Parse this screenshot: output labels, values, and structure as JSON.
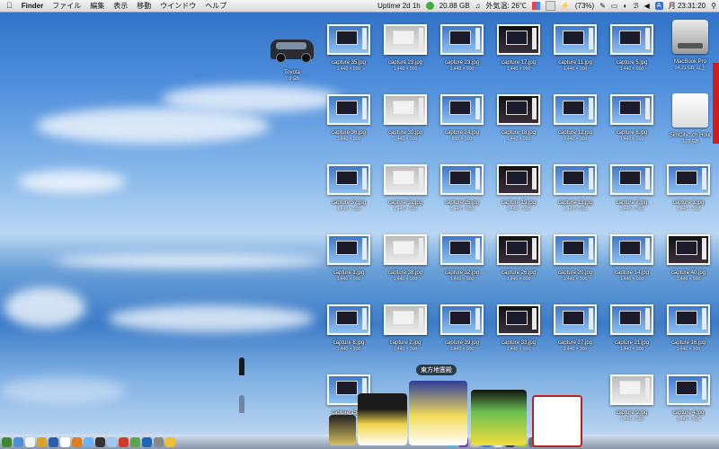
{
  "menubar": {
    "apple": "",
    "items": [
      "Finder",
      "ファイル",
      "編集",
      "表示",
      "移動",
      "ウインドウ",
      "ヘルプ"
    ],
    "status": {
      "uptime": "Uptime 2d 1h",
      "disk": "20.88 GB",
      "temperature": "外気温: 26℃",
      "battery": "(73%)",
      "clock": "月 23:31:20"
    }
  },
  "desktop": {
    "van_icon": {
      "label": "Toyota",
      "sub": "7.9 GB"
    },
    "drives": [
      {
        "label": "MacBook Pro",
        "sub": "24.21 GB, 以上"
      },
      {
        "label": "SimCity...ch Hour",
        "sub": "1.22 GB"
      }
    ],
    "files": [
      {
        "label": "capture 35.jpg",
        "sub": "1,440 × 900"
      },
      {
        "label": "capture 23.jpg",
        "sub": "1,440 × 900"
      },
      {
        "label": "capture 23.jpg",
        "sub": "1,440 × 900"
      },
      {
        "label": "capture 17.jpg",
        "sub": "1,440 × 900"
      },
      {
        "label": "capture 11.jpg",
        "sub": "1,440 × 900"
      },
      {
        "label": "capture 5.jpg",
        "sub": "1,440 × 900"
      },
      {
        "label": "capture 36.jpg",
        "sub": "1,440 × 900"
      },
      {
        "label": "capture 30.jpg",
        "sub": "1,440 × 900"
      },
      {
        "label": "capture 24.jpg",
        "sub": "800 × 600"
      },
      {
        "label": "capture 18.jpg",
        "sub": "1,440 × 900"
      },
      {
        "label": "capture 12.jpg",
        "sub": "1,440 × 900"
      },
      {
        "label": "capture 6.jpg",
        "sub": "1,440 × 900"
      },
      {
        "label": "capture 37.jpg",
        "sub": "1,440 × 900"
      },
      {
        "label": "capture 31.jpg",
        "sub": "1,440 × 900"
      },
      {
        "label": "capture 25.jpg",
        "sub": "1,440 × 900"
      },
      {
        "label": "capture 19.jpg",
        "sub": "1,440 × 900"
      },
      {
        "label": "capture 13.jpg",
        "sub": "1,440 × 900"
      },
      {
        "label": "capture 7.jpg",
        "sub": "1,440 × 900"
      },
      {
        "label": "capture 1.jpg",
        "sub": "1,440 × 900"
      },
      {
        "label": "capture 38.jpg",
        "sub": "1,440 × 900"
      },
      {
        "label": "capture 32.jpg",
        "sub": "1,440 × 900"
      },
      {
        "label": "capture 26.jpg",
        "sub": "1,440 × 900"
      },
      {
        "label": "capture 20.jpg",
        "sub": "1,440 × 900"
      },
      {
        "label": "capture 14.jpg",
        "sub": "1,440 × 900"
      },
      {
        "label": "capture 8.jpg",
        "sub": "1,440 × 900"
      },
      {
        "label": "capture 2.jpg",
        "sub": "1,440 × 900"
      },
      {
        "label": "capture 39.jpg",
        "sub": "1,440 × 900"
      },
      {
        "label": "capture 33.jpg",
        "sub": "1,440 × 900"
      },
      {
        "label": "capture 27.jpg",
        "sub": "1,440 × 900"
      },
      {
        "label": "capture 21.jpg",
        "sub": "1,440 × 900"
      },
      {
        "label": "capture 15.jpg",
        "sub": "1,440 × 900"
      },
      {
        "label": "capture 9.jpg",
        "sub": "1,440 × 900"
      },
      {
        "label": "capture 3.jpg",
        "sub": "1,440 × 900"
      },
      {
        "label": "capture 40.jpg",
        "sub": "1,440 × 900"
      },
      {
        "label": "capture 16.jpg",
        "sub": "1,440 × 900"
      },
      {
        "label": "capture 4.jpg",
        "sub": "1,440 × 900"
      }
    ]
  },
  "dock": {
    "tooltip": "東方地霊殿",
    "colors": [
      "#3b8a2f",
      "#4a8fd9",
      "#f2f2f2",
      "#d8a420",
      "#2a5ea8",
      "#ffffff",
      "#e07b1e",
      "#6ab3ff",
      "#333333",
      "#9cc7f0",
      "#d23a2a",
      "#57a84a",
      "#1e63b5",
      "#888888",
      "#f0c030",
      "#4dbbe0",
      "#7a3da8",
      "#c0c0c0",
      "#2f7ed8",
      "#e8e8e8",
      "#3d3d3d",
      "#9acd32",
      "#607080",
      "#f4f4f4",
      "#1f9fd0",
      "#e25a2a"
    ]
  },
  "colors": {
    "menubar": "#e6e6e6",
    "accent": "#2d6fc4"
  }
}
